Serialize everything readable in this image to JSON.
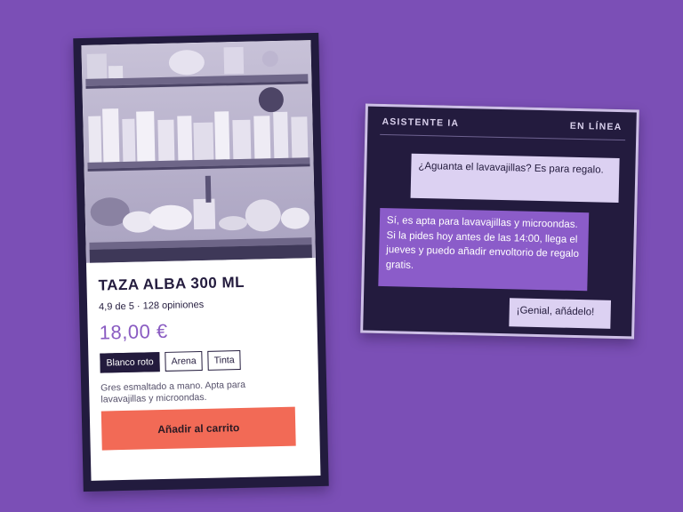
{
  "product": {
    "title": "TAZA ALBA 300 ML",
    "rating": "4,9 de 5 · 128 opiniones",
    "price": "18,00 €",
    "variants": [
      {
        "label": "Blanco roto",
        "selected": true
      },
      {
        "label": "Arena",
        "selected": false
      },
      {
        "label": "Tinta",
        "selected": false
      }
    ],
    "description": "Gres esmaltado a mano. Apta para lavavajillas y microondas.",
    "add_to_cart": "Añadir al carrito",
    "image": "pottery-shelves-photo"
  },
  "assistant": {
    "title": "ASISTENTE IA",
    "status": "EN LÍNEA",
    "messages": [
      {
        "role": "user",
        "text": "¿Aguanta el lavavajillas? Es para regalo."
      },
      {
        "role": "assistant",
        "text": "Sí, es apta para lavavajillas y microondas. Si la pides hoy antes de las 14:00, llega el jueves y puedo añadir envoltorio de regalo gratis."
      },
      {
        "role": "user",
        "text": "¡Genial, añádelo!"
      }
    ]
  },
  "colors": {
    "background": "#7b4fb6",
    "frame": "#221b3e",
    "price": "#8a5cc2",
    "cta": "#f26a56",
    "user_bubble": "#dcd1f2",
    "bot_bubble": "#8b5cc9"
  }
}
